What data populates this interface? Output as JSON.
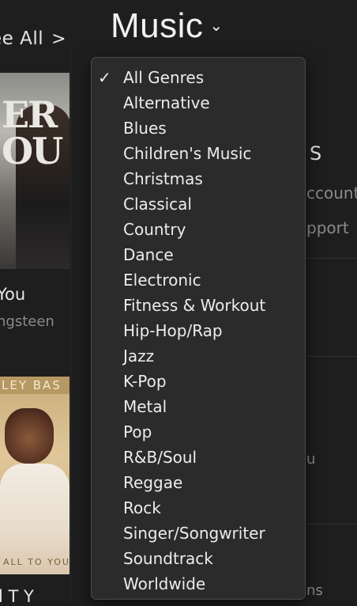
{
  "header": {
    "see_all_label": "ee All",
    "see_all_chevron": ">",
    "title": "Music",
    "title_caret": "⌄"
  },
  "background": {
    "album1": {
      "art_text": "ER\nOU",
      "title_fragment": "You",
      "artist_fragment": "ngsteen"
    },
    "album2": {
      "art_top_text": "LEY BAS",
      "art_bottom_text": "ALL TO YOU",
      "title_fragment": "l T  Y"
    },
    "right_panel": {
      "s_fragment": "S",
      "account_fragment": "ccount",
      "support_fragment": "pport",
      "u_fragment": "u",
      "ns_fragment": "ns"
    }
  },
  "genre_menu": {
    "selected": "All Genres",
    "check_glyph": "✓",
    "items": [
      "All Genres",
      "Alternative",
      "Blues",
      "Children's Music",
      "Christmas",
      "Classical",
      "Country",
      "Dance",
      "Electronic",
      "Fitness & Workout",
      "Hip-Hop/Rap",
      "Jazz",
      "K-Pop",
      "Metal",
      "Pop",
      "R&B/Soul",
      "Reggae",
      "Rock",
      "Singer/Songwriter",
      "Soundtrack",
      "Worldwide"
    ]
  }
}
